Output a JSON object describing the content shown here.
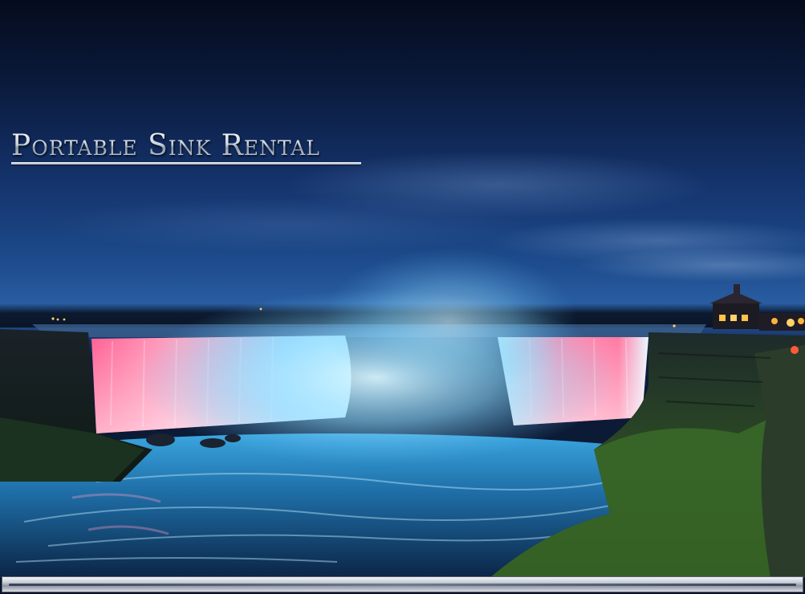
{
  "page": {
    "title": "Portable Sink Rental"
  },
  "background": {
    "scene": "waterfall-at-night",
    "accent_colors": {
      "sky_deep": "#0a1a3c",
      "sky_mid": "#1d4b8c",
      "falls_pink": "#ff7aa6",
      "falls_cyan": "#7fe4ff",
      "cliff_green": "#3d6a2a",
      "lights_amber": "#ffc24a"
    }
  },
  "footer": {
    "bar": "scrollbar-style-divider"
  }
}
